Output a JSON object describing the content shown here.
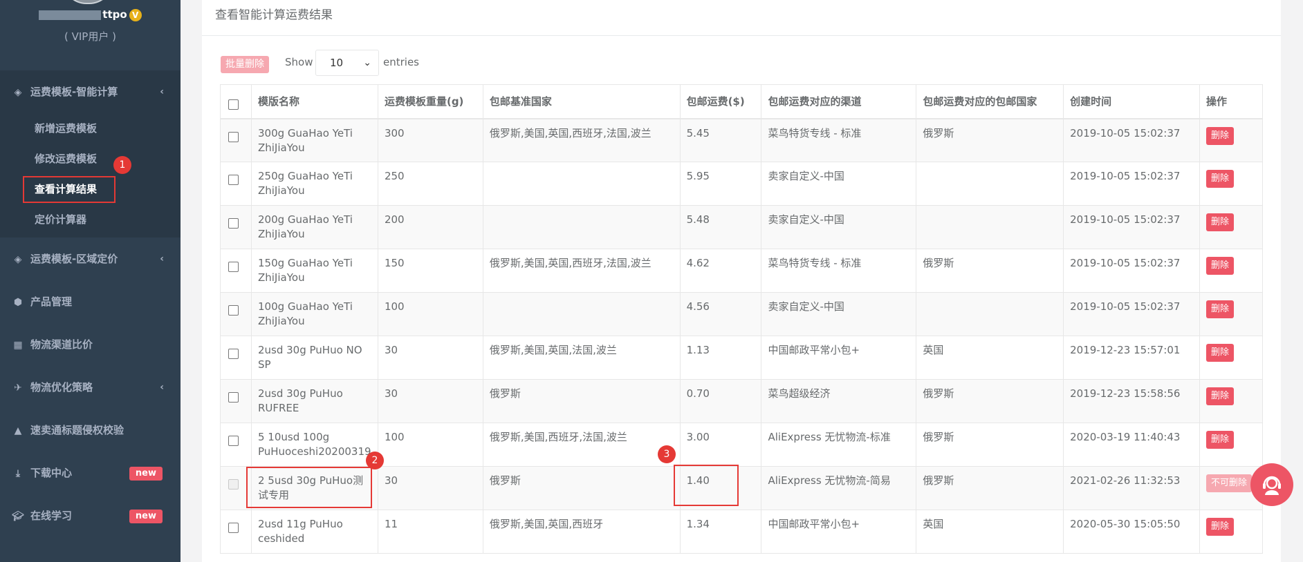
{
  "user": {
    "name_visible": "ttpo",
    "vip_mark": "V",
    "role": "( VIP用户 )"
  },
  "sidebar": {
    "items": [
      {
        "label": "运费模板-智能计算",
        "icon": "diamond-icon",
        "expanded": true,
        "children": [
          "新增运费模板",
          "修改运费模板",
          "查看计算结果",
          "定价计算器"
        ]
      },
      {
        "label": "运费模板-区域定价",
        "icon": "diamond-icon"
      },
      {
        "label": "产品管理",
        "icon": "cube-icon"
      },
      {
        "label": "物流渠道比价",
        "icon": "calculator-icon"
      },
      {
        "label": "物流优化策略",
        "icon": "plane-icon"
      },
      {
        "label": "速卖通标题侵权校验",
        "icon": "warning-icon"
      },
      {
        "label": "下载中心",
        "icon": "download-icon",
        "badge": "new"
      },
      {
        "label": "在线学习",
        "icon": "graduation-cap-icon",
        "badge": "new"
      }
    ],
    "active_child": "查看计算结果"
  },
  "annotations": {
    "step1": "1",
    "step2": "2",
    "step3": "3"
  },
  "main": {
    "title": "查看智能计算运费结果",
    "batch_delete": "批量删除",
    "show_label": "Show",
    "entries_value": "10",
    "entries_label": "entries",
    "columns": [
      "模版名称",
      "运费模板重量(g)",
      "包邮基准国家",
      "包邮运费($)",
      "包邮运费对应的渠道",
      "包邮运费对应的包邮国家",
      "创建时间",
      "操作"
    ],
    "rows": [
      {
        "name": "300g GuaHao YeTi ZhiJiaYou",
        "weight": "300",
        "base_countries": "俄罗斯,美国,英国,西班牙,法国,波兰",
        "fee": "5.45",
        "channel": "菜鸟特货专线 - 标准",
        "free_country": "俄罗斯",
        "created": "2019-10-05 15:02:37",
        "action": "删除",
        "deletable": true
      },
      {
        "name": "250g GuaHao YeTi ZhiJiaYou",
        "weight": "250",
        "base_countries": "",
        "fee": "5.95",
        "channel": "卖家自定义-中国",
        "free_country": "",
        "created": "2019-10-05 15:02:37",
        "action": "删除",
        "deletable": true
      },
      {
        "name": "200g GuaHao YeTi ZhiJiaYou",
        "weight": "200",
        "base_countries": "",
        "fee": "5.48",
        "channel": "卖家自定义-中国",
        "free_country": "",
        "created": "2019-10-05 15:02:37",
        "action": "删除",
        "deletable": true
      },
      {
        "name": "150g GuaHao YeTi ZhiJiaYou",
        "weight": "150",
        "base_countries": "俄罗斯,美国,英国,西班牙,法国,波兰",
        "fee": "4.62",
        "channel": "菜鸟特货专线 - 标准",
        "free_country": "俄罗斯",
        "created": "2019-10-05 15:02:37",
        "action": "删除",
        "deletable": true
      },
      {
        "name": "100g GuaHao YeTi ZhiJiaYou",
        "weight": "100",
        "base_countries": "",
        "fee": "4.56",
        "channel": "卖家自定义-中国",
        "free_country": "",
        "created": "2019-10-05 15:02:37",
        "action": "删除",
        "deletable": true
      },
      {
        "name": "2usd 30g PuHuo NO SP",
        "weight": "30",
        "base_countries": "俄罗斯,美国,英国,法国,波兰",
        "fee": "1.13",
        "channel": "中国邮政平常小包+",
        "free_country": "英国",
        "created": "2019-12-23 15:57:01",
        "action": "删除",
        "deletable": true
      },
      {
        "name": "2usd 30g PuHuo RUFREE",
        "weight": "30",
        "base_countries": "俄罗斯",
        "fee": "0.70",
        "channel": "菜鸟超级经济",
        "free_country": "俄罗斯",
        "created": "2019-12-23 15:58:56",
        "action": "删除",
        "deletable": true
      },
      {
        "name": "5 10usd 100g PuHuoceshi20200319",
        "weight": "100",
        "base_countries": "俄罗斯,美国,西班牙,法国,波兰",
        "fee": "3.00",
        "channel": "AliExpress 无忧物流-标准",
        "free_country": "俄罗斯",
        "created": "2020-03-19 11:40:43",
        "action": "删除",
        "deletable": true
      },
      {
        "name": "2 5usd 30g PuHuo测试专用",
        "weight": "30",
        "base_countries": "俄罗斯",
        "fee": "1.40",
        "channel": "AliExpress 无忧物流-简易",
        "free_country": "俄罗斯",
        "created": "2021-02-26 11:32:53",
        "action": "不可删除",
        "deletable": false
      },
      {
        "name": "2usd 11g PuHuo ceshided",
        "weight": "11",
        "base_countries": "俄罗斯,美国,英国,西班牙",
        "fee": "1.34",
        "channel": "中国邮政平常小包+",
        "free_country": "英国",
        "created": "2020-05-30 15:05:50",
        "action": "删除",
        "deletable": true
      }
    ]
  },
  "colors": {
    "sidebar_bg": "#2f4050",
    "danger": "#ed5565",
    "annotation": "#e53935"
  }
}
